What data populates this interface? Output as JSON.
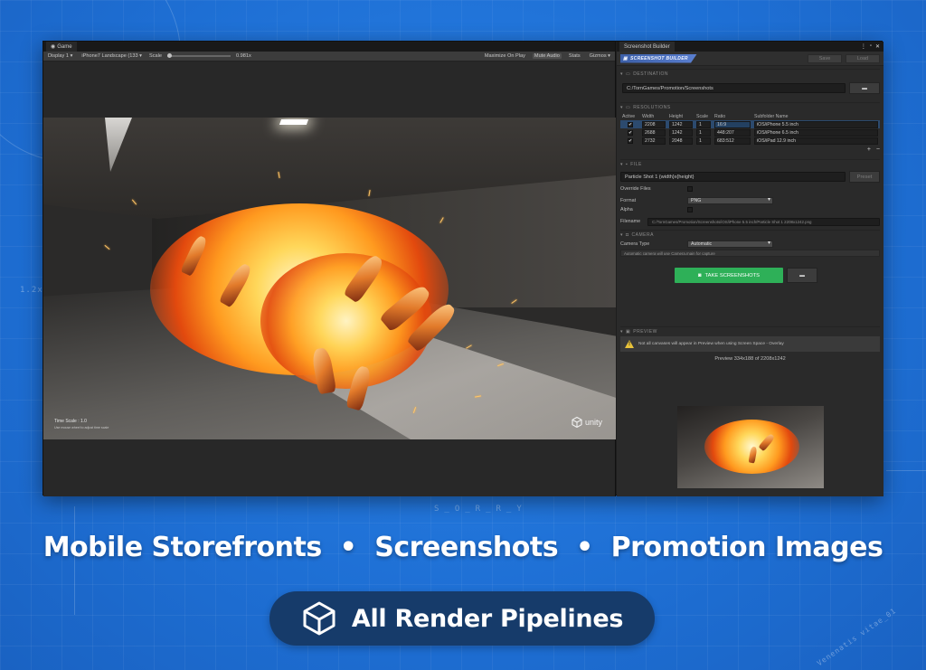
{
  "game": {
    "tab_label": "Game",
    "toolbar": {
      "display": "Display 1",
      "resolution": "iPhone7 Landscape (133",
      "scale_label": "Scale",
      "scale_value": "0.981x",
      "maximize": "Maximize On Play",
      "mute": "Mute Audio",
      "stats": "Stats",
      "gizmos": "Gizmos"
    },
    "viewport": {
      "time_scale": "Time Scale : 1.0",
      "hint": "Use mouse wheel to adjust time scale",
      "logo_text": "unity"
    }
  },
  "builder": {
    "tab_label": "Screenshot Builder",
    "brand": "SCREENSHOT BUILDER",
    "save_label": "Save",
    "load_label": "Load",
    "destination": {
      "header": "DESTINATION",
      "path": "C:/TornGames/Promotion/Screenshots"
    },
    "resolutions": {
      "header": "RESOLUTIONS",
      "columns": [
        "Active",
        "Width",
        "Height",
        "Scale",
        "Ratio",
        "Subfolder Name"
      ],
      "rows": [
        {
          "active": "✔",
          "width": "2208",
          "height": "1242",
          "scale": "1",
          "ratio": "16:9",
          "subfolder": "iOS/iPhone 5.5 inch"
        },
        {
          "active": "✔",
          "width": "2688",
          "height": "1242",
          "scale": "1",
          "ratio": "448:207",
          "subfolder": "iOS/iPhone 6.5 inch"
        },
        {
          "active": "✔",
          "width": "2732",
          "height": "2048",
          "scale": "1",
          "ratio": "683:512",
          "subfolder": "iOS/iPad 12.9 inch"
        }
      ],
      "add": "+",
      "remove": "−"
    },
    "file": {
      "header": "FILE",
      "name_template": "Particle Shot 1 {width}x{height}",
      "preset_label": "Preset",
      "override_label": "Override Files",
      "format_label": "Format",
      "format_value": "PNG",
      "alpha_label": "Alpha",
      "filename_label": "Filename",
      "filename_value": "C:/TornGames/Promotion/Screenshots/iOS/iPhone 5.5 inch/Particle Shot 1 2208x1242.png"
    },
    "camera": {
      "header": "CAMERA",
      "type_label": "Camera Type",
      "type_value": "Automatic",
      "note": "Automatic camera will use Camera.main for capture"
    },
    "take_label": "TAKE SCREENSHOTS",
    "preview": {
      "header": "PREVIEW",
      "warning": "Not all canvases will appear in Preview when using Screen Space - Overlay",
      "caption": "Preview 334x188 of 2208x1242"
    }
  },
  "background": {
    "deco_text": "S_O_R_R_Y",
    "deco_left": "1.2x",
    "deco_right": "Venenatis vitae_01"
  },
  "tagline": {
    "item1": "Mobile Storefronts",
    "sep1": "•",
    "item2": "Screenshots",
    "sep2": "•",
    "item3": "Promotion Images"
  },
  "pill": {
    "label": "All Render Pipelines",
    "icon": "cube-icon"
  },
  "colors": {
    "background": "#1f74d9",
    "take_button": "#2eb058",
    "pill": "#163b6a",
    "brand": "#4a6fc0"
  }
}
